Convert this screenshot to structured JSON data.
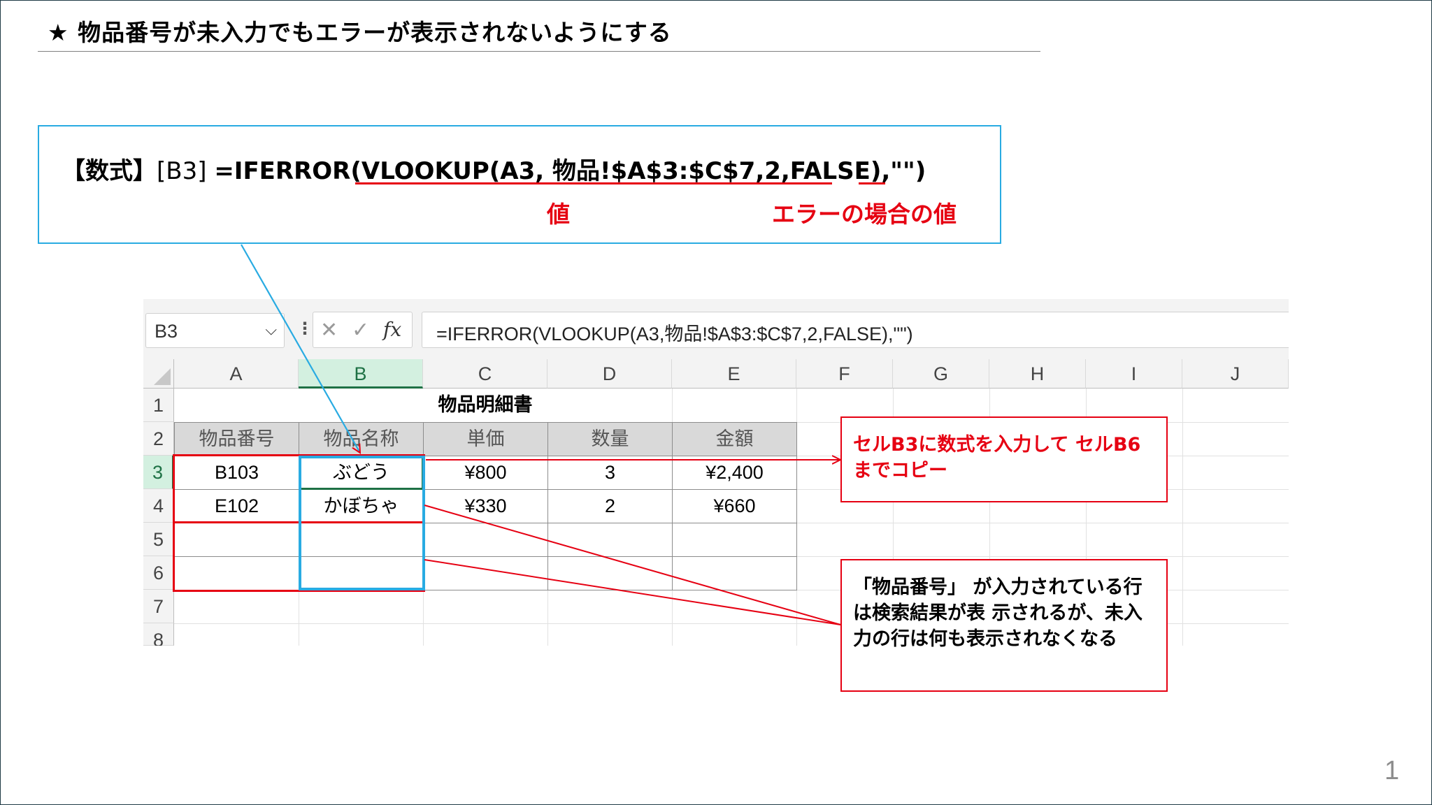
{
  "slide": {
    "title": "★ 物品番号が未入力でもエラーが表示されないようにする",
    "page_number": "1"
  },
  "formula_callout": {
    "label": "【数式】",
    "cell_ref": "[B3]",
    "formula_prefix": "=IFERROR(",
    "formula_value_part": "VLOOKUP(A3, 物品!$A$3:$C$7,2,FALSE)",
    "formula_sep": ",",
    "formula_error_part": "\"\"",
    "formula_suffix": ")",
    "annotation_value": "値",
    "annotation_error": "エラーの場合の値"
  },
  "excel": {
    "name_box": "B3",
    "formula_bar": "=IFERROR(VLOOKUP(A3,物品!$A$3:$C$7,2,FALSE),\"\")",
    "column_headers": [
      "A",
      "B",
      "C",
      "D",
      "E",
      "F",
      "G",
      "H",
      "I",
      "J"
    ],
    "row_headers": [
      "1",
      "2",
      "3",
      "4",
      "5",
      "6",
      "7",
      "8"
    ],
    "sheet_title": "物品明細書",
    "table_headers": [
      "物品番号",
      "物品名称",
      "単価",
      "数量",
      "金額"
    ],
    "rows": [
      [
        "B103",
        "ぶどう",
        "¥800",
        "3",
        "¥2,400"
      ],
      [
        "E102",
        "かぼちゃ",
        "¥330",
        "2",
        "¥660"
      ],
      [
        "",
        "",
        "",
        "",
        ""
      ],
      [
        "",
        "",
        "",
        "",
        ""
      ]
    ]
  },
  "notes": {
    "copy_note": "セルB3に数式を入力して セルB6までコピー",
    "result_note": "「物品番号」 が入力されている行は検索結果が表 示されるが、未入力の行は何も表示されなくなる"
  },
  "colors": {
    "accent_red": "#e60012",
    "accent_blue": "#29abe2",
    "excel_green": "#1e7145"
  }
}
